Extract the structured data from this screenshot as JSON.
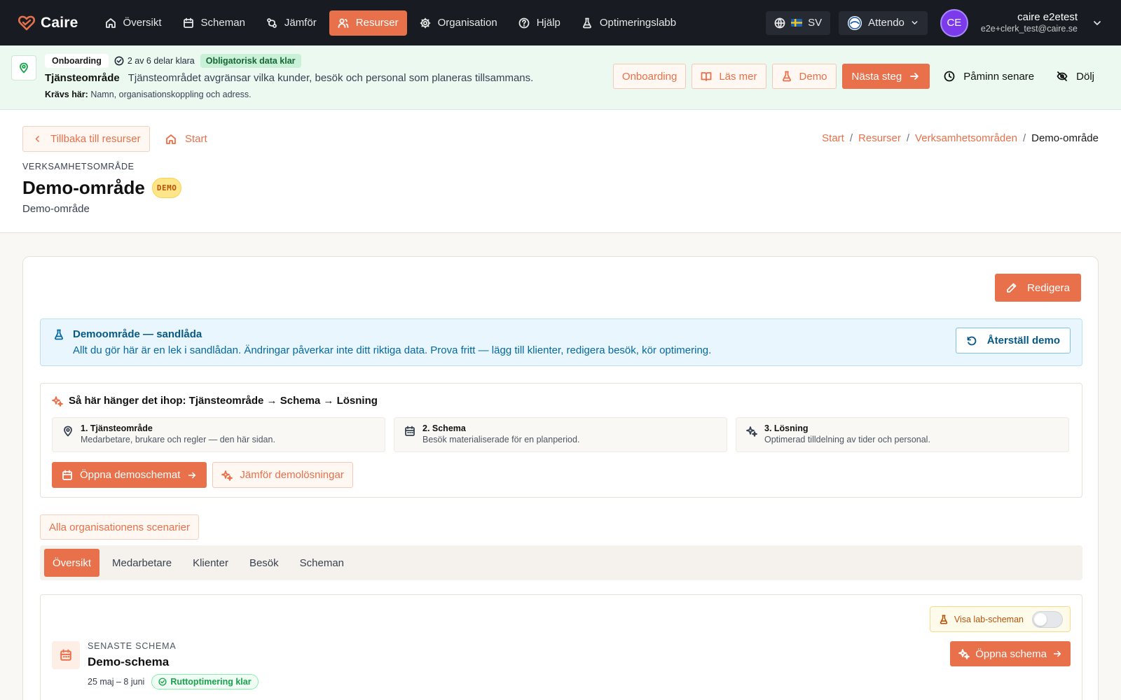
{
  "app": {
    "name": "Caire"
  },
  "nav": {
    "items": [
      {
        "label": "Översikt",
        "icon": "home-icon"
      },
      {
        "label": "Scheman",
        "icon": "calendar-icon"
      },
      {
        "label": "Jämför",
        "icon": "compare-icon"
      },
      {
        "label": "Resurser",
        "icon": "users-icon",
        "active": true
      },
      {
        "label": "Organisation",
        "icon": "gear-icon"
      },
      {
        "label": "Hjälp",
        "icon": "help-icon"
      },
      {
        "label": "Optimeringslabb",
        "icon": "flask-icon"
      }
    ]
  },
  "top_right": {
    "language": "SV",
    "org": "Attendo",
    "user_initials": "CE",
    "user_name": "caire e2etest",
    "user_email": "e2e+clerk_test@caire.se"
  },
  "onboarding": {
    "badge": "Onboarding",
    "steps_done": "2 av 6 delar klara",
    "required_badge": "Obligatorisk data klar",
    "title": "Tjänsteområde",
    "description": "Tjänsteområdet avgränsar vilka kunder, besök och personal som planeras tillsammans.",
    "required_label": "Krävs här:",
    "required_text": "Namn, organisationskoppling och adress.",
    "btn_onboarding": "Onboarding",
    "btn_read_more": "Läs mer",
    "btn_demo": "Demo",
    "btn_next": "Nästa steg",
    "btn_remind": "Påminn senare",
    "btn_hide": "Dölj"
  },
  "header": {
    "back_label": "Tillbaka till resurser",
    "start_label": "Start",
    "breadcrumb": [
      "Start",
      "Resurser",
      "Verksamhetsområden",
      "Demo-område"
    ],
    "eyebrow": "VERKSAMHETSOMRÅDE",
    "title": "Demo-område",
    "badge": "DEMO",
    "subtitle": "Demo-område"
  },
  "main": {
    "edit_label": "Redigera",
    "sandbox": {
      "title": "Demoområde — sandlåda",
      "description": "Allt du gör här är en lek i sandlådan. Ändringar påverkar inte ditt riktiga data. Prova fritt — lägg till klienter, redigera besök, kör optimering.",
      "reset_label": "Återställ demo"
    },
    "howto": {
      "title": "Så här hänger det ihop: Tjänsteområde → Schema → Lösning",
      "steps": [
        {
          "title": "1. Tjänsteområde",
          "desc": "Medarbetare, brukare och regler — den här sidan."
        },
        {
          "title": "2. Schema",
          "desc": "Besök materialiserade för en planperiod."
        },
        {
          "title": "3. Lösning",
          "desc": "Optimerad tilldelning av tider och personal."
        }
      ],
      "open_demo_label": "Öppna demoschemat",
      "compare_label": "Jämför demolösningar"
    },
    "scenarios_label": "Alla organisationens scenarier",
    "tabs": [
      {
        "label": "Översikt",
        "active": true
      },
      {
        "label": "Medarbetare"
      },
      {
        "label": "Klienter"
      },
      {
        "label": "Besök"
      },
      {
        "label": "Scheman"
      }
    ],
    "schedule": {
      "lab_toggle_label": "Visa lab-scheman",
      "lab_toggle_on": false,
      "eyebrow": "SENASTE SCHEMA",
      "title": "Demo-schema",
      "dates": "25 maj – 8 juni",
      "status": "Ruttoptimering klar",
      "open_label": "Öppna schema"
    }
  },
  "colors": {
    "accent": "#e8704a",
    "topbar": "#181c22",
    "onboarding_bg": "#ebf9f0",
    "info_bg": "#eaf6fd"
  }
}
